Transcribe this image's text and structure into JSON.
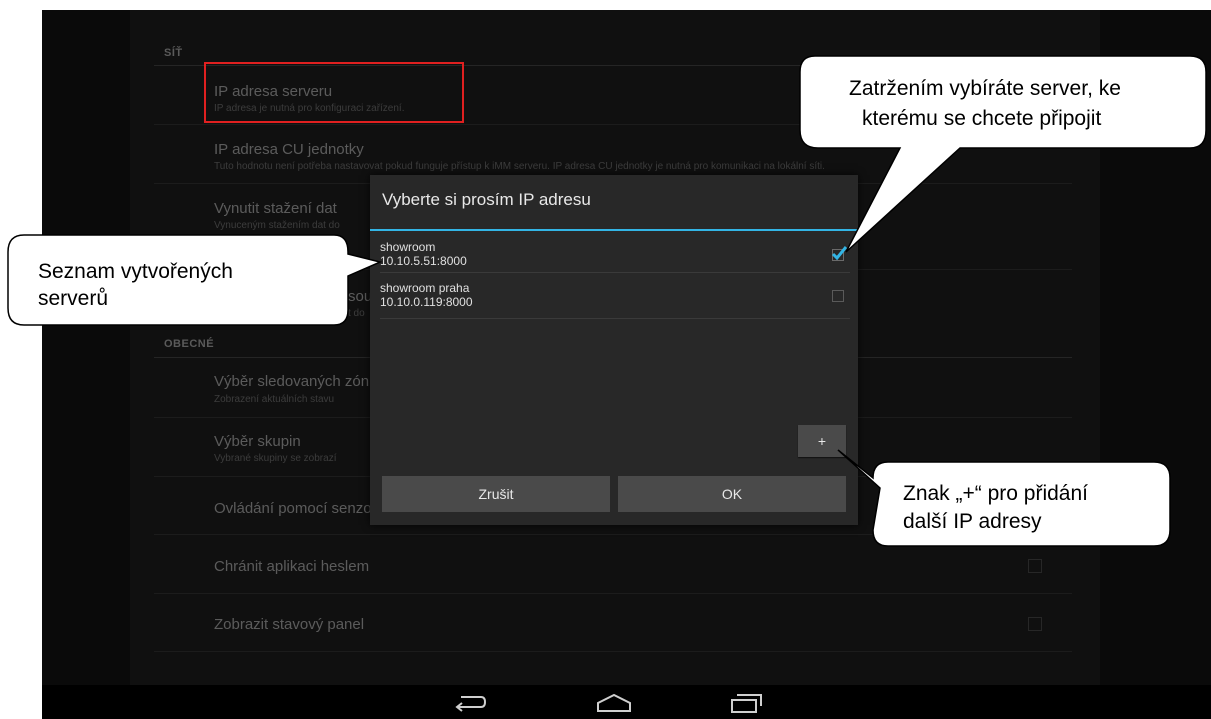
{
  "settings": {
    "section_network": "SÍŤ",
    "section_general": "OBECNÉ",
    "items": [
      {
        "title": "IP adresa serveru",
        "subtitle": "IP adresa je nutná pro konfiguraci zařízení."
      },
      {
        "title": "IP adresa CU jednotky",
        "subtitle": "Tuto hodnotu není potřeba nastavovat pokud funguje přístup k iMM serveru. IP adresa CU jednotky je nutná pro komunikaci na lokální síti."
      },
      {
        "title": "Vynutit stažení dat",
        "subtitle": "Vynuceným stažením dat do"
      },
      {
        "title": "sou",
        "subtitle": "t do"
      },
      {
        "title": "Výběr sledovaných zón",
        "subtitle": "Zobrazení aktuálních stavu"
      },
      {
        "title": "Výběr skupin",
        "subtitle": "Vybrané skupiny se zobrazí"
      },
      {
        "title": "Ovládání pomocí senzorů",
        "subtitle": ""
      },
      {
        "title": "Chránit aplikaci heslem",
        "subtitle": ""
      },
      {
        "title": "Zobrazit stavový panel",
        "subtitle": ""
      }
    ]
  },
  "dialog": {
    "title": "Vyberte si prosím IP adresu",
    "servers": [
      {
        "name": "showroom",
        "address": "10.10.5.51:8000",
        "checked": true
      },
      {
        "name": "showroom praha",
        "address": "10.10.0.119:8000",
        "checked": false
      }
    ],
    "add_label": "+",
    "cancel_label": "Zrušit",
    "ok_label": "OK"
  },
  "callouts": {
    "top_right": [
      "Zatržením vybíráte server, ke",
      "kterému se chcete připojit"
    ],
    "left": [
      "Seznam vytvořených",
      "serverů"
    ],
    "bottom_right": [
      "Znak „+“ pro přidání",
      "další IP adresy"
    ]
  },
  "navbar": {
    "icons": [
      "back-icon",
      "home-icon",
      "recent-apps-icon"
    ]
  },
  "colors": {
    "accent": "#33b5e5",
    "highlight_box": "#e02020"
  }
}
